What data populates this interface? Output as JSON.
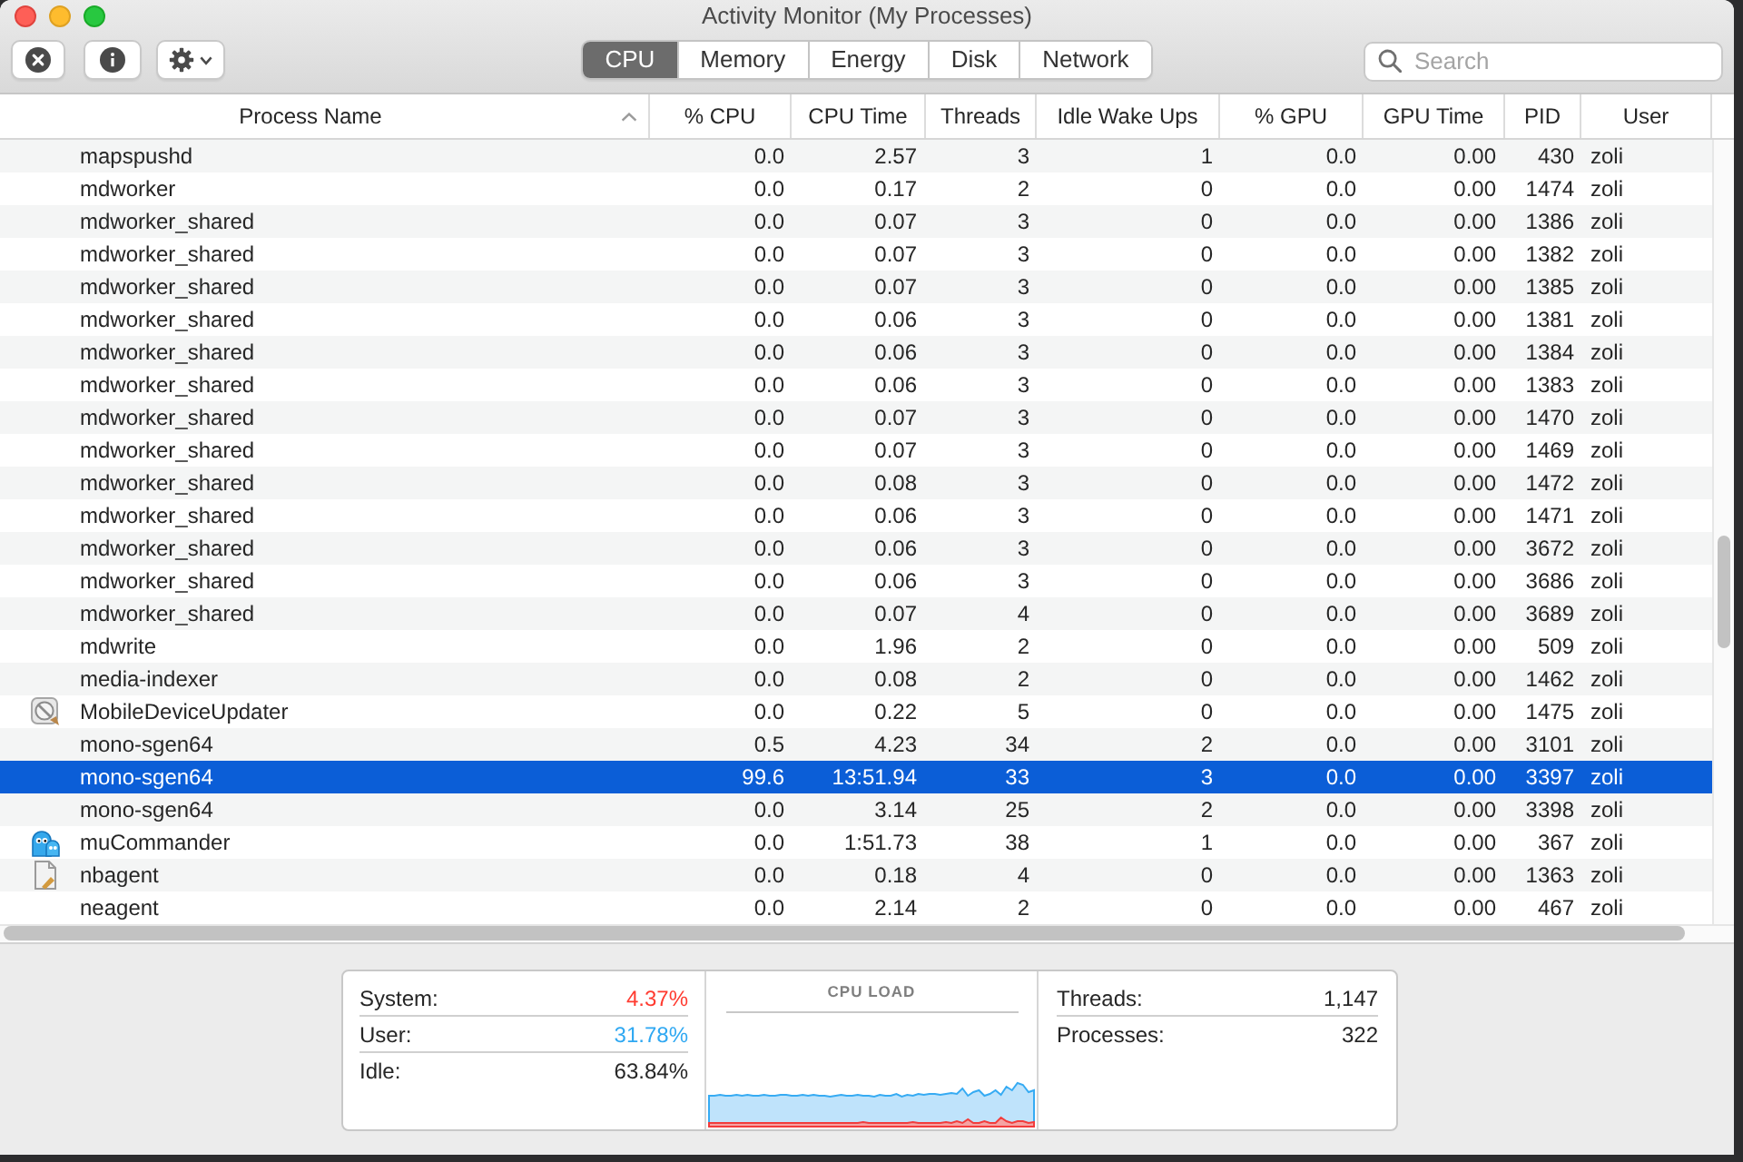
{
  "window": {
    "title": "Activity Monitor (My Processes)"
  },
  "tabs": [
    {
      "label": "CPU",
      "selected": true
    },
    {
      "label": "Memory",
      "selected": false
    },
    {
      "label": "Energy",
      "selected": false
    },
    {
      "label": "Disk",
      "selected": false
    },
    {
      "label": "Network",
      "selected": false
    }
  ],
  "search": {
    "placeholder": "Search"
  },
  "table": {
    "columns": [
      {
        "label": "Process Name",
        "sorted": true
      },
      {
        "label": "% CPU",
        "sorted": false
      },
      {
        "label": "CPU Time",
        "sorted": false
      },
      {
        "label": "Threads",
        "sorted": false
      },
      {
        "label": "Idle Wake Ups",
        "sorted": false
      },
      {
        "label": "% GPU",
        "sorted": false
      },
      {
        "label": "GPU Time",
        "sorted": false
      },
      {
        "label": "PID",
        "sorted": false
      },
      {
        "label": "User",
        "sorted": false
      }
    ],
    "rows": [
      {
        "kind": "daemon",
        "selected": false,
        "cells": [
          "mapspushd",
          "0.0",
          "2.57",
          "3",
          "1",
          "0.0",
          "0.00",
          "430",
          "zoli"
        ]
      },
      {
        "kind": "daemon",
        "selected": false,
        "cells": [
          "mdworker",
          "0.0",
          "0.17",
          "2",
          "0",
          "0.0",
          "0.00",
          "1474",
          "zoli"
        ]
      },
      {
        "kind": "daemon",
        "selected": false,
        "cells": [
          "mdworker_shared",
          "0.0",
          "0.07",
          "3",
          "0",
          "0.0",
          "0.00",
          "1386",
          "zoli"
        ]
      },
      {
        "kind": "daemon",
        "selected": false,
        "cells": [
          "mdworker_shared",
          "0.0",
          "0.07",
          "3",
          "0",
          "0.0",
          "0.00",
          "1382",
          "zoli"
        ]
      },
      {
        "kind": "daemon",
        "selected": false,
        "cells": [
          "mdworker_shared",
          "0.0",
          "0.07",
          "3",
          "0",
          "0.0",
          "0.00",
          "1385",
          "zoli"
        ]
      },
      {
        "kind": "daemon",
        "selected": false,
        "cells": [
          "mdworker_shared",
          "0.0",
          "0.06",
          "3",
          "0",
          "0.0",
          "0.00",
          "1381",
          "zoli"
        ]
      },
      {
        "kind": "daemon",
        "selected": false,
        "cells": [
          "mdworker_shared",
          "0.0",
          "0.06",
          "3",
          "0",
          "0.0",
          "0.00",
          "1384",
          "zoli"
        ]
      },
      {
        "kind": "daemon",
        "selected": false,
        "cells": [
          "mdworker_shared",
          "0.0",
          "0.06",
          "3",
          "0",
          "0.0",
          "0.00",
          "1383",
          "zoli"
        ]
      },
      {
        "kind": "daemon",
        "selected": false,
        "cells": [
          "mdworker_shared",
          "0.0",
          "0.07",
          "3",
          "0",
          "0.0",
          "0.00",
          "1470",
          "zoli"
        ]
      },
      {
        "kind": "daemon",
        "selected": false,
        "cells": [
          "mdworker_shared",
          "0.0",
          "0.07",
          "3",
          "0",
          "0.0",
          "0.00",
          "1469",
          "zoli"
        ]
      },
      {
        "kind": "daemon",
        "selected": false,
        "cells": [
          "mdworker_shared",
          "0.0",
          "0.08",
          "3",
          "0",
          "0.0",
          "0.00",
          "1472",
          "zoli"
        ]
      },
      {
        "kind": "daemon",
        "selected": false,
        "cells": [
          "mdworker_shared",
          "0.0",
          "0.06",
          "3",
          "0",
          "0.0",
          "0.00",
          "1471",
          "zoli"
        ]
      },
      {
        "kind": "daemon",
        "selected": false,
        "cells": [
          "mdworker_shared",
          "0.0",
          "0.06",
          "3",
          "0",
          "0.0",
          "0.00",
          "3672",
          "zoli"
        ]
      },
      {
        "kind": "daemon",
        "selected": false,
        "cells": [
          "mdworker_shared",
          "0.0",
          "0.06",
          "3",
          "0",
          "0.0",
          "0.00",
          "3686",
          "zoli"
        ]
      },
      {
        "kind": "daemon",
        "selected": false,
        "cells": [
          "mdworker_shared",
          "0.0",
          "0.07",
          "4",
          "0",
          "0.0",
          "0.00",
          "3689",
          "zoli"
        ]
      },
      {
        "kind": "daemon",
        "selected": false,
        "cells": [
          "mdwrite",
          "0.0",
          "1.96",
          "2",
          "0",
          "0.0",
          "0.00",
          "509",
          "zoli"
        ]
      },
      {
        "kind": "daemon",
        "selected": false,
        "cells": [
          "media-indexer",
          "0.0",
          "0.08",
          "2",
          "0",
          "0.0",
          "0.00",
          "1462",
          "zoli"
        ]
      },
      {
        "kind": "updater",
        "selected": false,
        "cells": [
          "MobileDeviceUpdater",
          "0.0",
          "0.22",
          "5",
          "0",
          "0.0",
          "0.00",
          "1475",
          "zoli"
        ]
      },
      {
        "kind": "daemon",
        "selected": false,
        "cells": [
          "mono-sgen64",
          "0.5",
          "4.23",
          "34",
          "2",
          "0.0",
          "0.00",
          "3101",
          "zoli"
        ]
      },
      {
        "kind": "daemon",
        "selected": true,
        "cells": [
          "mono-sgen64",
          "99.6",
          "13:51.94",
          "33",
          "3",
          "0.0",
          "0.00",
          "3397",
          "zoli"
        ]
      },
      {
        "kind": "daemon",
        "selected": false,
        "cells": [
          "mono-sgen64",
          "0.0",
          "3.14",
          "25",
          "2",
          "0.0",
          "0.00",
          "3398",
          "zoli"
        ]
      },
      {
        "kind": "app",
        "selected": false,
        "cells": [
          "muCommander",
          "0.0",
          "1:51.73",
          "38",
          "1",
          "0.0",
          "0.00",
          "367",
          "zoli"
        ]
      },
      {
        "kind": "agent",
        "selected": false,
        "cells": [
          "nbagent",
          "0.0",
          "0.18",
          "4",
          "0",
          "0.0",
          "0.00",
          "1363",
          "zoli"
        ]
      },
      {
        "kind": "daemon",
        "selected": false,
        "cells": [
          "neagent",
          "0.0",
          "2.14",
          "2",
          "0",
          "0.0",
          "0.00",
          "467",
          "zoli"
        ]
      }
    ]
  },
  "summary": {
    "cpu": [
      {
        "label": "System:",
        "value": "4.37%",
        "color": "#ff3b30"
      },
      {
        "label": "User:",
        "value": "31.78%",
        "color": "#2fa8f2"
      },
      {
        "label": "Idle:",
        "value": "63.84%",
        "color": "#262626"
      }
    ],
    "chart_title": "CPU LOAD",
    "counts": [
      {
        "label": "Threads:",
        "value": "1,147"
      },
      {
        "label": "Processes:",
        "value": "322"
      }
    ]
  }
}
